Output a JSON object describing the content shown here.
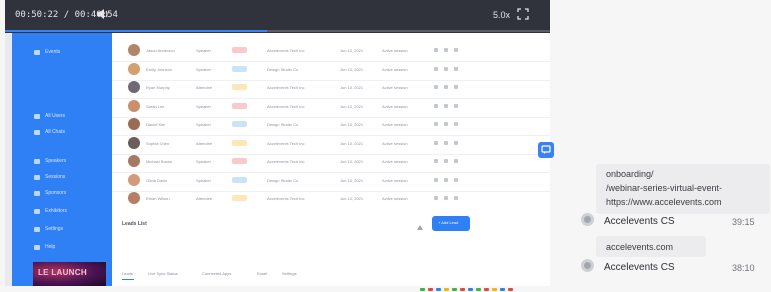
{
  "player": {
    "time_label": "00:50:22 / 00:40:54",
    "speed_label": "5.0x",
    "progress": 0.48
  },
  "app": {
    "sidebar_items": [
      {
        "label": "Events"
      },
      {
        "label": "All Users"
      },
      {
        "label": "All Chats"
      },
      {
        "label": "Speakers"
      },
      {
        "label": "Sessions"
      },
      {
        "label": "Sponsors"
      },
      {
        "label": "Exhibitors"
      },
      {
        "label": "Settings"
      },
      {
        "label": "Help"
      }
    ],
    "brand_text": "LE LAUNCH",
    "title": "Leads List",
    "add_button": "+ Add Lead",
    "tabs": [
      "Leads",
      "Live Sync Status",
      "Connected Apps",
      "Email",
      "Settings"
    ],
    "rows": [
      {
        "name": "Jason Anderson",
        "role": "Speaker",
        "badge_color": "#f9c9cd",
        "company": "Accelevents Tech Inc",
        "date": "Jun 10, 2021",
        "status": "Active session"
      },
      {
        "name": "Emily Johnson",
        "role": "Speaker",
        "badge_color": "#c9e3f9",
        "company": "Design Studio Co",
        "date": "Jun 10, 2021",
        "status": "Active session"
      },
      {
        "name": "Ryan Murphy",
        "role": "Attendee",
        "badge_color": "#fde7b8",
        "company": "Accelevents Tech Inc",
        "date": "Jun 10, 2021",
        "status": "Active session"
      },
      {
        "name": "Sarah Lee",
        "role": "Speaker",
        "badge_color": "#f9c9cd",
        "company": "Accelevents Tech Inc",
        "date": "Jun 10, 2021",
        "status": "Active session"
      },
      {
        "name": "Daniel Kim",
        "role": "Speaker",
        "badge_color": "#c9e3f9",
        "company": "Design Studio Co",
        "date": "Jun 10, 2021",
        "status": "Active session"
      },
      {
        "name": "Sophia Chen",
        "role": "Attendee",
        "badge_color": "#fde7b8",
        "company": "Accelevents Tech Inc",
        "date": "Jun 10, 2021",
        "status": "Active session"
      },
      {
        "name": "Michael Brown",
        "role": "Speaker",
        "badge_color": "#f9c9cd",
        "company": "Accelevents Tech Inc",
        "date": "Jun 10, 2021",
        "status": "Active session"
      },
      {
        "name": "Olivia Davis",
        "role": "Speaker",
        "badge_color": "#c9e3f9",
        "company": "Design Studio Co",
        "date": "Jun 10, 2021",
        "status": "Active session"
      },
      {
        "name": "Ethan Wilson",
        "role": "Attendee",
        "badge_color": "#fde7b8",
        "company": "Accelevents Tech Inc",
        "date": "Jun 10, 2021",
        "status": "Active session"
      }
    ]
  },
  "chat": {
    "messages": [
      {
        "sender": "Accelevents CS",
        "time": "39:15",
        "lines": [
          "https://www.accelevents.com",
          "/webinar-series-virtual-event-",
          "onboarding/"
        ]
      },
      {
        "sender": "Accelevents CS",
        "time": "38:10",
        "lines": [
          "accelevents.com"
        ]
      }
    ]
  },
  "colors": {
    "accent": "#2f7ff5",
    "player_bar": "#30323c",
    "chat_bubble": "#ececee"
  },
  "icons": [
    "volume-icon",
    "fullscreen-icon",
    "chat-toggle-icon",
    "avatar-icon"
  ]
}
